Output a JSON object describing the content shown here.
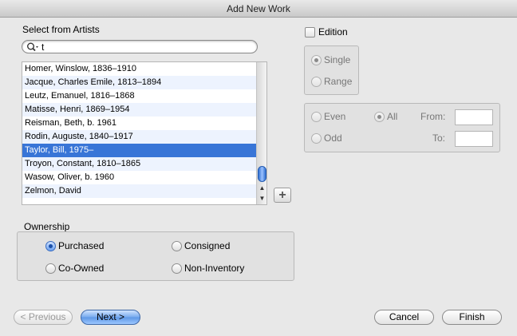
{
  "window": {
    "title": "Add New Work"
  },
  "artists": {
    "label": "Select from Artists",
    "search_value": "t",
    "items": [
      "Homer, Winslow, 1836–1910",
      "Jacque, Charles Emile, 1813–1894",
      "Leutz, Emanuel, 1816–1868",
      "Matisse, Henri, 1869–1954",
      "Reisman, Beth, b. 1961",
      "Rodin, Auguste, 1840–1917",
      "Taylor, Bill, 1975–",
      "Troyon, Constant, 1810–1865",
      "Wasow, Oliver, b. 1960",
      "Zelmon, David"
    ],
    "selected_index": 6,
    "add_label": "+"
  },
  "edition": {
    "label": "Edition",
    "checked": false,
    "type_options": [
      "Single",
      "Range"
    ],
    "type_selected": "Single",
    "parity_options": [
      "Even",
      "Odd"
    ],
    "all_label": "All",
    "from_label": "From:",
    "to_label": "To:",
    "from_value": "",
    "to_value": ""
  },
  "ownership": {
    "label": "Ownership",
    "options": [
      "Purchased",
      "Consigned",
      "Co-Owned",
      "Non-Inventory"
    ],
    "selected": "Purchased"
  },
  "buttons": {
    "previous": "< Previous",
    "next": "Next >",
    "cancel": "Cancel",
    "finish": "Finish"
  },
  "colors": {
    "selection": "#3875d7",
    "default_button": "#5d97e6"
  }
}
